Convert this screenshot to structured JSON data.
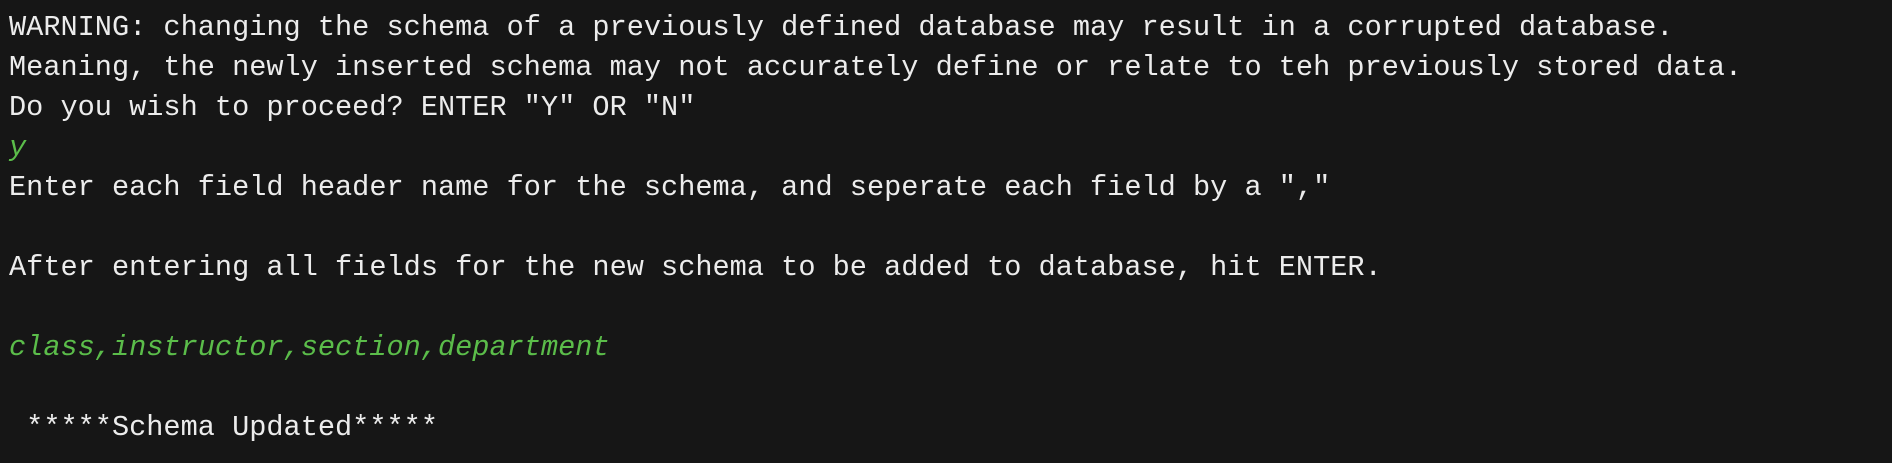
{
  "terminal": {
    "lines": [
      "WARNING: changing the schema of a previously defined database may result in a corrupted database.",
      "Meaning, the newly inserted schema may not accurately define or relate to teh previously stored data.",
      "Do you wish to proceed? ENTER \"Y\" OR \"N\"",
      "y",
      "Enter each field header name for the schema, and seperate each field by a \",\"",
      "After entering all fields for the new schema to be added to database, hit ENTER.",
      "class,instructor,section,department",
      " *****Schema Updated*****"
    ]
  },
  "colors": {
    "background": "#161616",
    "output_text": "#ececec",
    "user_input_text": "#5bbd4a"
  }
}
